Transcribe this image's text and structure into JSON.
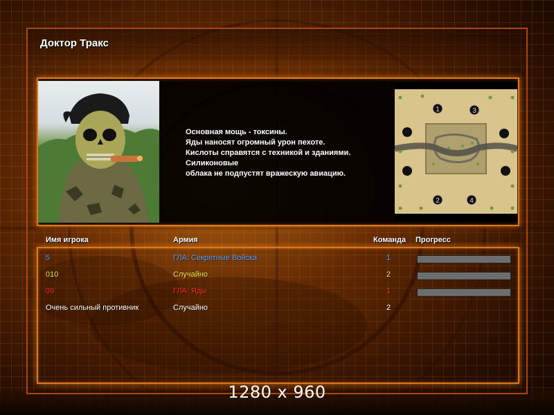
{
  "title": "Доктор Тракс",
  "description": [
    "Основная мощь - токсины.",
    "Яды наносят огромный урон пехоте.",
    "Кислоты справятся с техникой и зданиями.",
    "Силиконовые",
    "облака не подпустят вражескую авиацию."
  ],
  "minimap": {
    "start_positions": [
      "1",
      "3",
      "2",
      "4"
    ]
  },
  "table": {
    "headers": {
      "player": "Имя игрока",
      "army": "Армия",
      "team": "Команда",
      "progress": "Прогресс"
    },
    "rows": [
      {
        "name": "5",
        "army": "ГЛА: Секретные Войска",
        "team": "1",
        "color": "#5aa0ff",
        "progress_bar": true
      },
      {
        "name": "010",
        "army": "Случайно",
        "team": "2",
        "color": "#f0ea3a",
        "progress_bar": true
      },
      {
        "name": "09",
        "army": "ГЛА: Яды",
        "team": "1",
        "color": "#ff2a1a",
        "progress_bar": true
      },
      {
        "name": "Очень сильный противник",
        "army": "Случайно",
        "team": "2",
        "color": "#ffffff",
        "progress_bar": false
      }
    ]
  },
  "resolution_label": "1280 x 960",
  "colors": {
    "frame": "#e0771a",
    "background": "#8c3c05"
  }
}
